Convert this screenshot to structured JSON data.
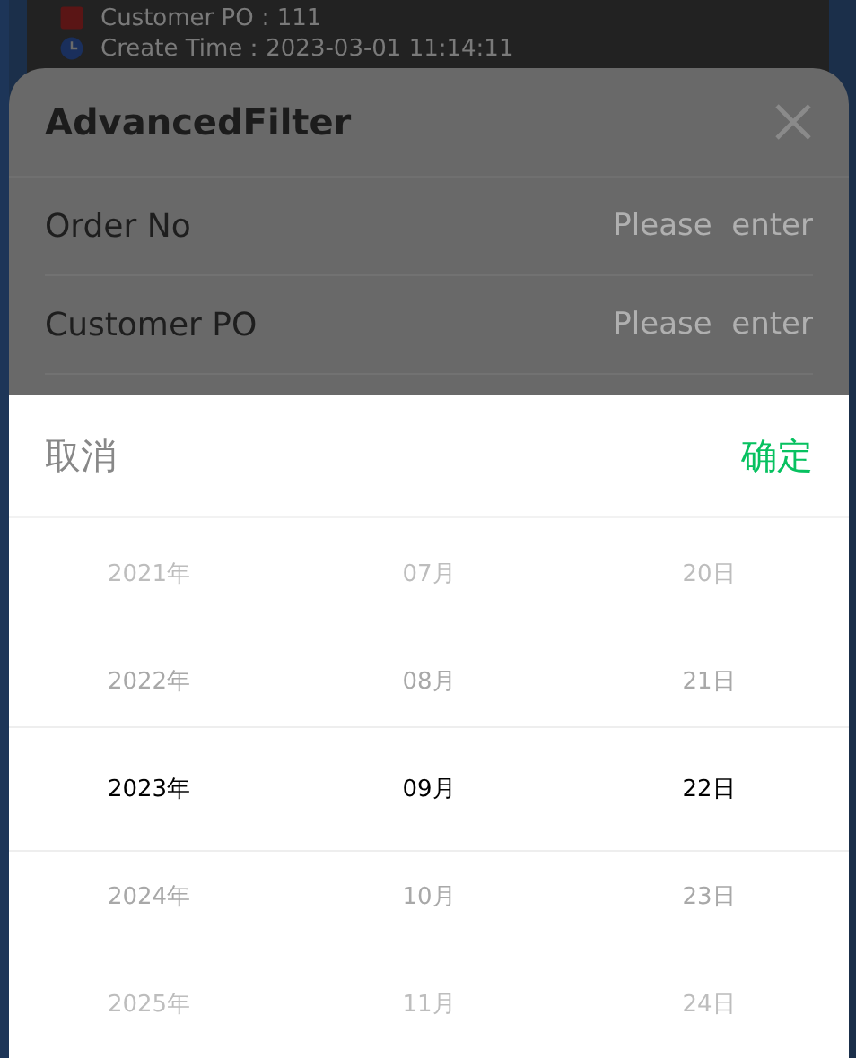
{
  "background_details": [
    {
      "kind": "po",
      "text": "Customer PO：111"
    },
    {
      "kind": "time",
      "text": "Create Time：2023-03-01 11:14:11"
    }
  ],
  "filter_sheet": {
    "title": "AdvancedFilter",
    "fields": [
      {
        "label": "Order No",
        "placeholder": "Please  enter"
      },
      {
        "label": "Customer PO",
        "placeholder": "Please  enter"
      }
    ]
  },
  "date_picker": {
    "cancel": "取消",
    "confirm": "确定",
    "columns": [
      [
        {
          "label": "2021年",
          "selected": false
        },
        {
          "label": "2022年",
          "selected": false
        },
        {
          "label": "2023年",
          "selected": true
        },
        {
          "label": "2024年",
          "selected": false
        },
        {
          "label": "2025年",
          "selected": false
        }
      ],
      [
        {
          "label": "07月",
          "selected": false
        },
        {
          "label": "08月",
          "selected": false
        },
        {
          "label": "09月",
          "selected": true
        },
        {
          "label": "10月",
          "selected": false
        },
        {
          "label": "11月",
          "selected": false
        }
      ],
      [
        {
          "label": "20日",
          "selected": false
        },
        {
          "label": "21日",
          "selected": false
        },
        {
          "label": "22日",
          "selected": true
        },
        {
          "label": "23日",
          "selected": false
        },
        {
          "label": "24日",
          "selected": false
        }
      ]
    ]
  }
}
